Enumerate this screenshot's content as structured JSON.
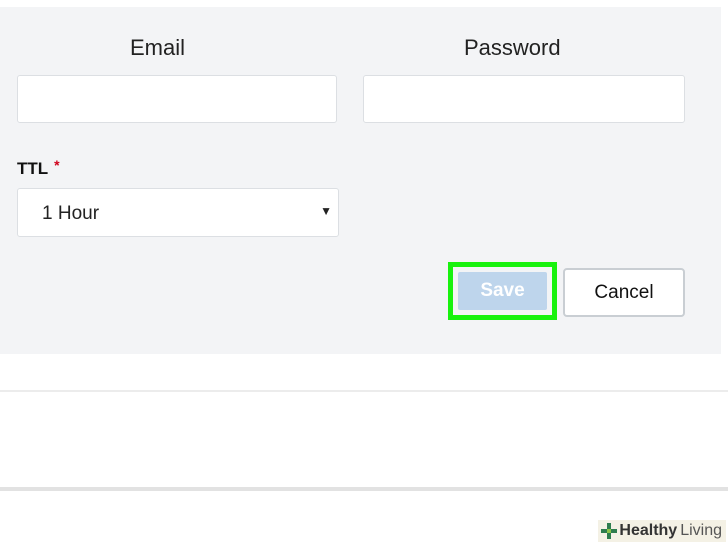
{
  "form": {
    "email_label": "Email",
    "email_value": "",
    "password_label": "Password",
    "password_value": "",
    "ttl_label": "TTL",
    "ttl_required_mark": "*",
    "ttl_selected": "1 Hour",
    "save_label": "Save",
    "cancel_label": "Cancel"
  },
  "colors": {
    "panel_bg": "#f3f4f6",
    "save_disabled": "#bed5ec",
    "highlight": "#18f20e",
    "required": "#d0021b"
  },
  "watermark": {
    "brand": "Healthy",
    "suffix": "Living"
  }
}
